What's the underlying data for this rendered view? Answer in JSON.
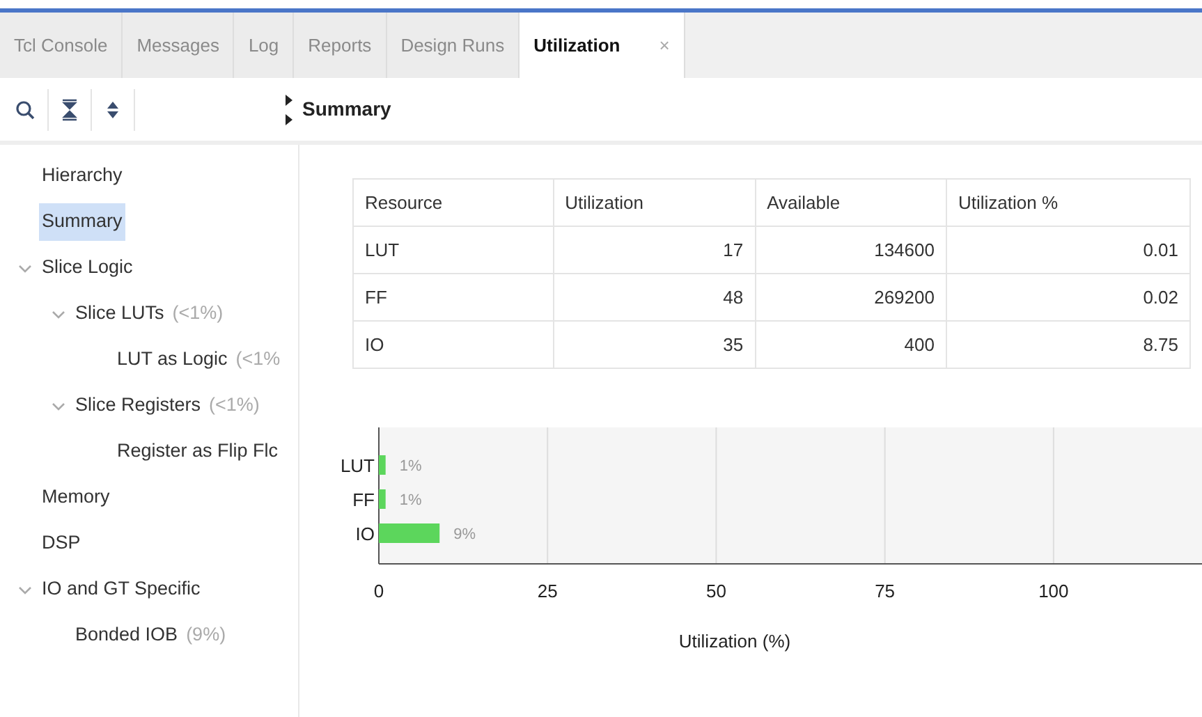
{
  "tabs": [
    {
      "label": "Tcl Console",
      "selected": false
    },
    {
      "label": "Messages",
      "selected": false
    },
    {
      "label": "Log",
      "selected": false
    },
    {
      "label": "Reports",
      "selected": false
    },
    {
      "label": "Design Runs",
      "selected": false
    },
    {
      "label": "Utilization",
      "selected": true,
      "close": "×"
    }
  ],
  "toolbar": {
    "section_title": "Summary"
  },
  "sidebar": {
    "items": [
      {
        "label": "Hierarchy",
        "selected": false
      },
      {
        "label": "Summary",
        "selected": true
      },
      {
        "label": "Slice Logic",
        "selected": false,
        "expanded": true,
        "children": [
          {
            "label": "Slice LUTs",
            "note": "(<1%)",
            "selected": false,
            "expanded": true,
            "children": [
              {
                "label": "LUT as Logic",
                "note": "(<1%",
                "selected": false
              }
            ]
          },
          {
            "label": "Slice Registers",
            "note": "(<1%)",
            "selected": false,
            "expanded": true,
            "children": [
              {
                "label": "Register as Flip Flc",
                "selected": false
              }
            ]
          }
        ]
      },
      {
        "label": "Memory",
        "selected": false
      },
      {
        "label": "DSP",
        "selected": false
      },
      {
        "label": "IO and GT Specific",
        "selected": false,
        "expanded": true,
        "children": [
          {
            "label": "Bonded IOB",
            "note": "(9%)",
            "selected": false
          }
        ]
      }
    ]
  },
  "table": {
    "columns": [
      "Resource",
      "Utilization",
      "Available",
      "Utilization %"
    ],
    "rows": [
      [
        "LUT",
        "17",
        "134600",
        "0.01"
      ],
      [
        "FF",
        "48",
        "269200",
        "0.02"
      ],
      [
        "IO",
        "35",
        "400",
        "8.75"
      ]
    ]
  },
  "chart_data": {
    "type": "bar",
    "orientation": "horizontal",
    "xlabel": "Utilization (%)",
    "categories": [
      "LUT",
      "FF",
      "IO"
    ],
    "series": [
      {
        "color": "#5cd65c",
        "values": [
          1,
          1,
          9
        ]
      }
    ],
    "grid": true,
    "xlim": [
      0,
      122
    ],
    "xticks": [
      0,
      25,
      50,
      75,
      100
    ],
    "value_labels": [
      "1%",
      "1%",
      "9%"
    ]
  }
}
